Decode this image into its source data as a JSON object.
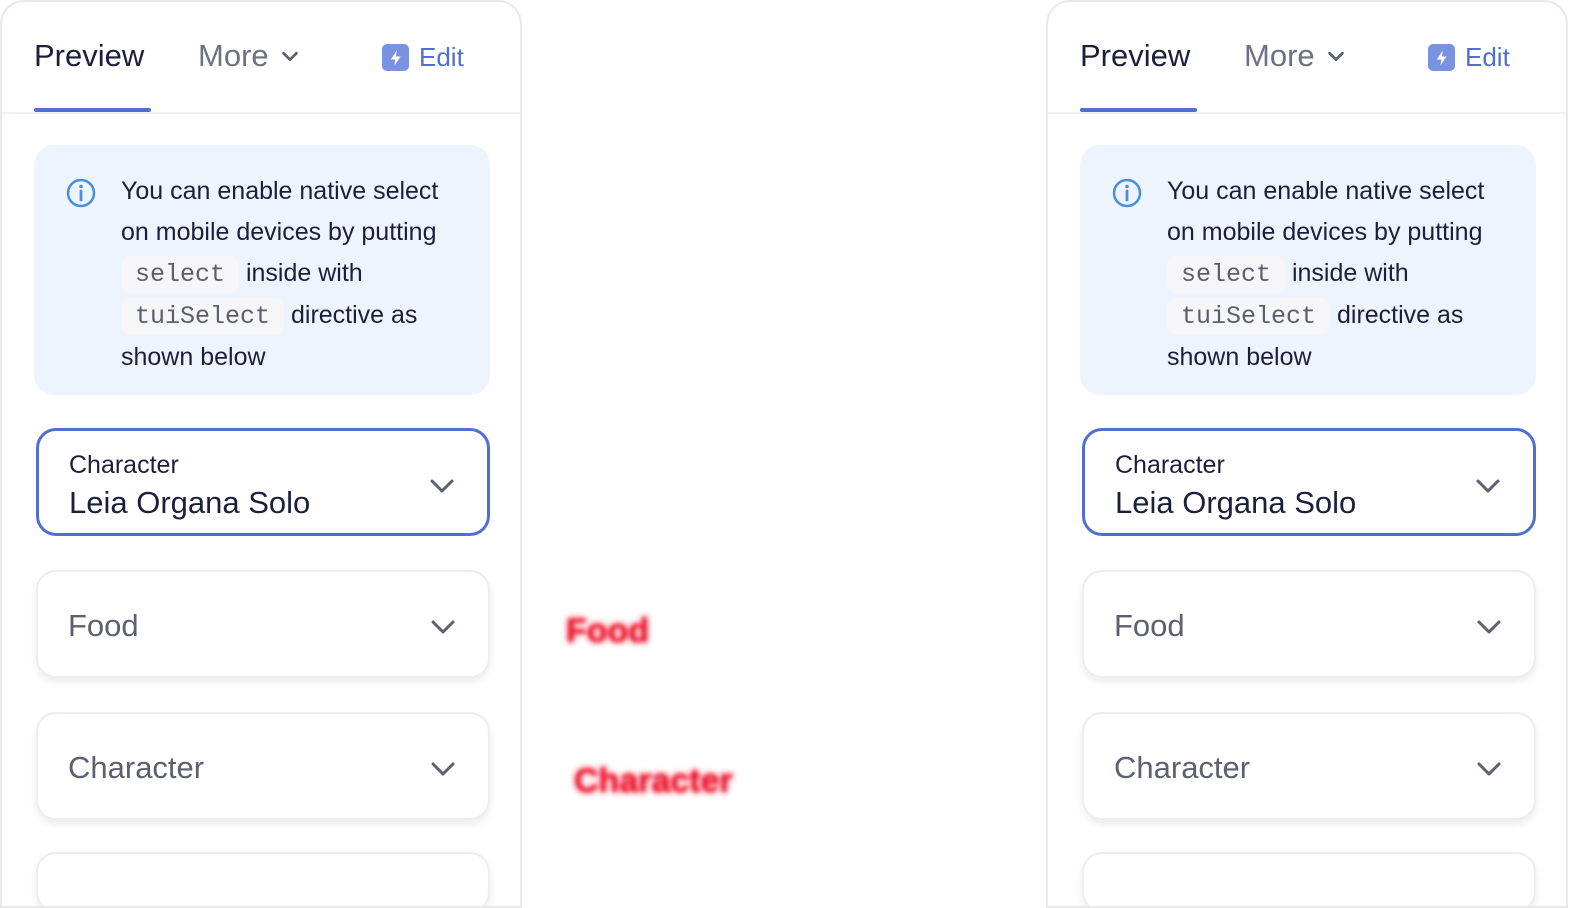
{
  "panels": [
    {
      "tabs": {
        "preview": "Preview",
        "more": "More",
        "edit": "Edit"
      },
      "info": {
        "line1": "You can enable native select on mobile devices by putting",
        "code1": "select",
        "line2": "inside with",
        "code2": "tuiSelect",
        "line3": "directive as shown below"
      },
      "selects": [
        {
          "label": "Character",
          "value": "Leia Organa Solo"
        },
        {
          "placeholder": "Food"
        },
        {
          "placeholder": "Character"
        }
      ]
    },
    {
      "tabs": {
        "preview": "Preview",
        "more": "More",
        "edit": "Edit"
      },
      "info": {
        "line1": "You can enable native select on mobile devices by putting",
        "code1": "select",
        "line2": "inside with",
        "code2": "tuiSelect",
        "line3": "directive as shown below"
      },
      "selects": [
        {
          "label": "Character",
          "value": "Leia Organa Solo"
        },
        {
          "placeholder": "Food"
        },
        {
          "placeholder": "Character"
        }
      ]
    }
  ],
  "scribbles": [
    "Food",
    "Character"
  ],
  "colors": {
    "accent": "#526ed3",
    "info_bg": "#edf4fd",
    "scribble": "#e8122d"
  },
  "icons": [
    "chevron-down-icon",
    "edit-icon",
    "info-icon"
  ]
}
